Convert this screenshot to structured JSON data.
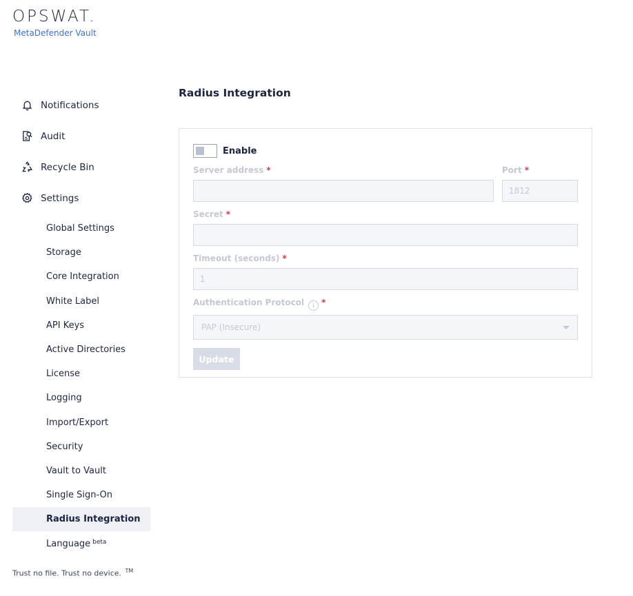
{
  "brand": {
    "logo": "OPSWAT.",
    "product": "MetaDefender Vault"
  },
  "sidebar": {
    "main": [
      {
        "label": "Notifications",
        "icon": "bell-icon"
      },
      {
        "label": "Audit",
        "icon": "audit-icon"
      },
      {
        "label": "Recycle Bin",
        "icon": "recycle-icon"
      },
      {
        "label": "Settings",
        "icon": "gear-icon"
      }
    ],
    "settings_items": [
      "Global Settings",
      "Storage",
      "Core Integration",
      "White Label",
      "API Keys",
      "Active Directories",
      "License",
      "Logging",
      "Import/Export",
      "Security",
      "Vault to Vault",
      "Single Sign-On",
      "Radius Integration"
    ],
    "language": {
      "label": "Language",
      "badge": "beta"
    },
    "active": "Radius Integration"
  },
  "footer": {
    "tagline": "Trust no file. Trust no device.",
    "tm": "TM"
  },
  "page": {
    "title": "Radius Integration"
  },
  "form": {
    "enable_label": "Enable",
    "enabled": false,
    "server_address_label": "Server address",
    "server_address_value": "",
    "port_label": "Port",
    "port_placeholder": "1812",
    "secret_label": "Secret",
    "secret_value": "",
    "timeout_label": "Timeout (seconds)",
    "timeout_value": "1",
    "protocol_label": "Authentication Protocol",
    "protocol_value": "PAP (Insecure)",
    "required_mark": "*",
    "info_glyph": "i",
    "update_label": "Update"
  },
  "colors": {
    "accent": "#3a72d6",
    "required": "#d9334a",
    "active_bg": "#eef0f5"
  }
}
